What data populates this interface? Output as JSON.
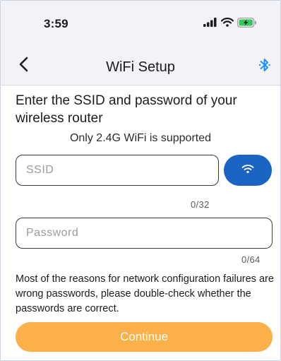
{
  "status_bar": {
    "time": "3:59",
    "icons": [
      "signal-icon",
      "wifi-icon",
      "battery-charging-icon"
    ]
  },
  "nav": {
    "title": "WiFi Setup",
    "back_icon": "chevron-left-icon",
    "bluetooth_icon": "bluetooth-icon"
  },
  "main": {
    "heading": "Enter the SSID and password of your wireless router",
    "subheading": "Only 2.4G WiFi is supported",
    "ssid": {
      "placeholder": "SSID",
      "value": "",
      "counter": "0/32"
    },
    "password": {
      "placeholder": "Password",
      "value": "",
      "counter": "0/64"
    },
    "wifi_scan_icon": "wifi-icon",
    "note": "Most of the reasons for network configuration failures are wrong passwords, please double-check whether the passwords are correct.",
    "continue_label": "Continue"
  },
  "colors": {
    "accent_blue": "#1b64c4",
    "continue_orange": "#fbb04a",
    "bluetooth_blue": "#1e90ff",
    "battery_green": "#34c759"
  }
}
